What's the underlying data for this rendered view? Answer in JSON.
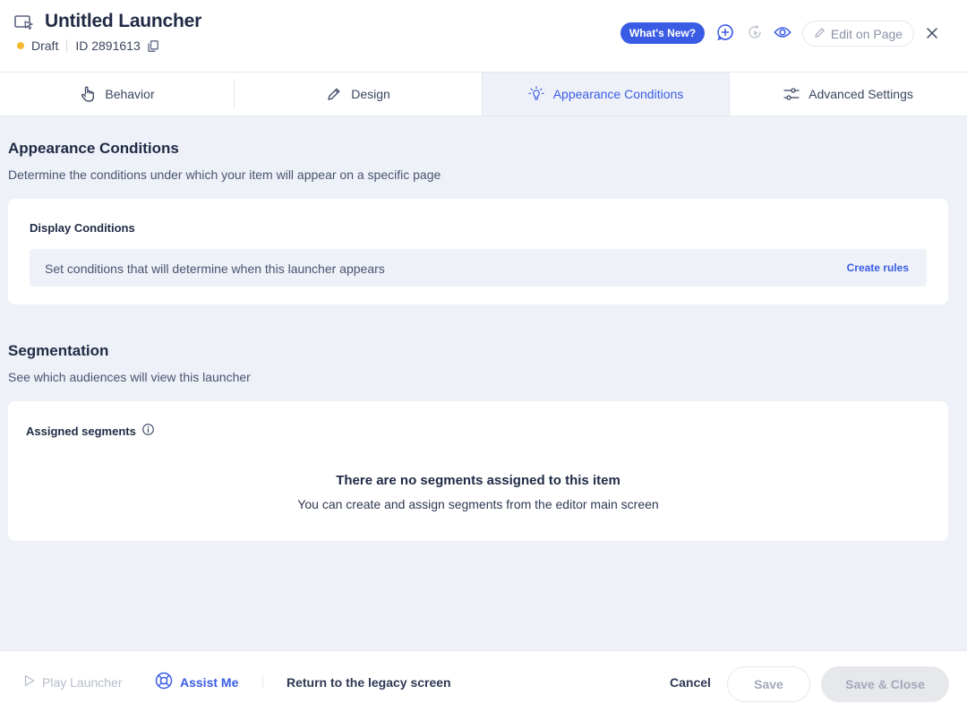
{
  "header": {
    "title": "Untitled Launcher",
    "status": "Draft",
    "status_color": "#f5b82e",
    "id_text": "ID 2891613",
    "whats_new": "What's New?",
    "edit_on_page": "Edit on Page",
    "icons": [
      "launcher-icon",
      "copy-icon",
      "add-circle-icon",
      "refresh-icon",
      "eye-icon",
      "pencil-icon",
      "close-icon"
    ]
  },
  "tabs": [
    {
      "label": "Behavior",
      "icon": "hand-pointer-icon",
      "active": false
    },
    {
      "label": "Design",
      "icon": "pencil-icon",
      "active": false
    },
    {
      "label": "Appearance Conditions",
      "icon": "lightbulb-icon",
      "active": true
    },
    {
      "label": "Advanced Settings",
      "icon": "sliders-icon",
      "active": false
    }
  ],
  "appearance": {
    "title": "Appearance Conditions",
    "subtitle": "Determine the conditions under which your item will appear on a specific page",
    "display_conditions": {
      "label": "Display Conditions",
      "text": "Set conditions that will determine when this launcher appears",
      "action": "Create rules"
    }
  },
  "segmentation": {
    "title": "Segmentation",
    "subtitle": "See which audiences will view this launcher",
    "assigned_label": "Assigned segments",
    "empty_title": "There are no segments assigned to this item",
    "empty_sub": "You can create and assign segments from the editor main screen"
  },
  "footer": {
    "play": "Play Launcher",
    "assist": "Assist Me",
    "legacy": "Return to the legacy screen",
    "cancel": "Cancel",
    "save": "Save",
    "save_close": "Save & Close"
  },
  "colors": {
    "accent": "#3a5ce5",
    "text": "#1f2a44",
    "background": "#eef1f8"
  }
}
